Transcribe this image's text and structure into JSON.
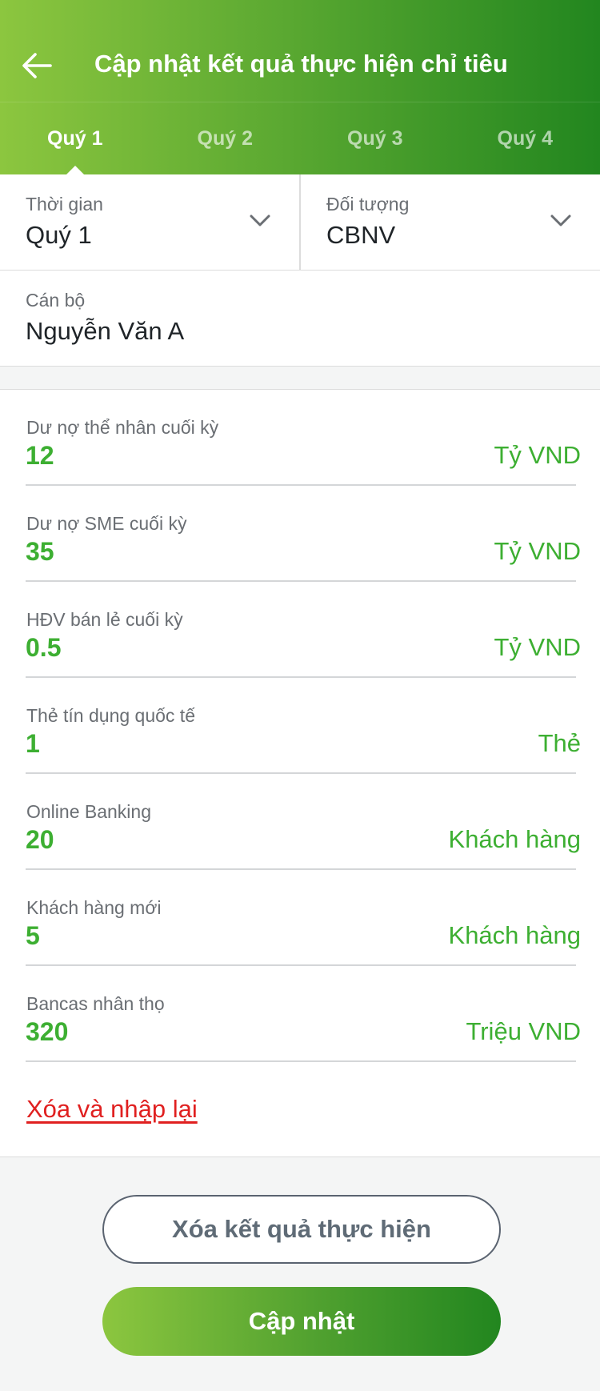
{
  "header": {
    "title": "Cập nhật kết quả thực hiện chỉ tiêu",
    "back_icon": "arrow-left-icon",
    "gradient": [
      "#8cc63f",
      "#22861f"
    ]
  },
  "tabs": [
    {
      "label": "Quý 1",
      "active": true
    },
    {
      "label": "Quý 2",
      "active": false
    },
    {
      "label": "Quý 3",
      "active": false
    },
    {
      "label": "Quý 4",
      "active": false
    }
  ],
  "filters": {
    "time": {
      "label": "Thời gian",
      "value": "Quý 1",
      "icon": "chevron-down-icon"
    },
    "target": {
      "label": "Đối tượng",
      "value": "CBNV",
      "icon": "chevron-down-icon"
    }
  },
  "staff": {
    "label": "Cán bộ",
    "value": "Nguyễn Văn A"
  },
  "metrics": [
    {
      "label": "Dư nợ thể nhân cuối kỳ",
      "value": "12",
      "unit": "Tỷ VND"
    },
    {
      "label": "Dư nợ SME cuối kỳ",
      "value": "35",
      "unit": "Tỷ VND"
    },
    {
      "label": "HĐV bán lẻ cuối kỳ",
      "value": "0.5",
      "unit": "Tỷ VND"
    },
    {
      "label": "Thẻ tín dụng quốc tế",
      "value": "1",
      "unit": "Thẻ"
    },
    {
      "label": "Online Banking",
      "value": "20",
      "unit": "Khách hàng"
    },
    {
      "label": "Khách hàng mới",
      "value": "5",
      "unit": "Khách hàng"
    },
    {
      "label": "Bancas nhân thọ",
      "value": "320",
      "unit": "Triệu VND"
    }
  ],
  "reset_link": "Xóa và nhập lại",
  "buttons": {
    "clear": "Xóa kết quả thực hiện",
    "update": "Cập nhật"
  },
  "colors": {
    "accent_green": "#3daf32",
    "danger_red": "#e02020"
  }
}
